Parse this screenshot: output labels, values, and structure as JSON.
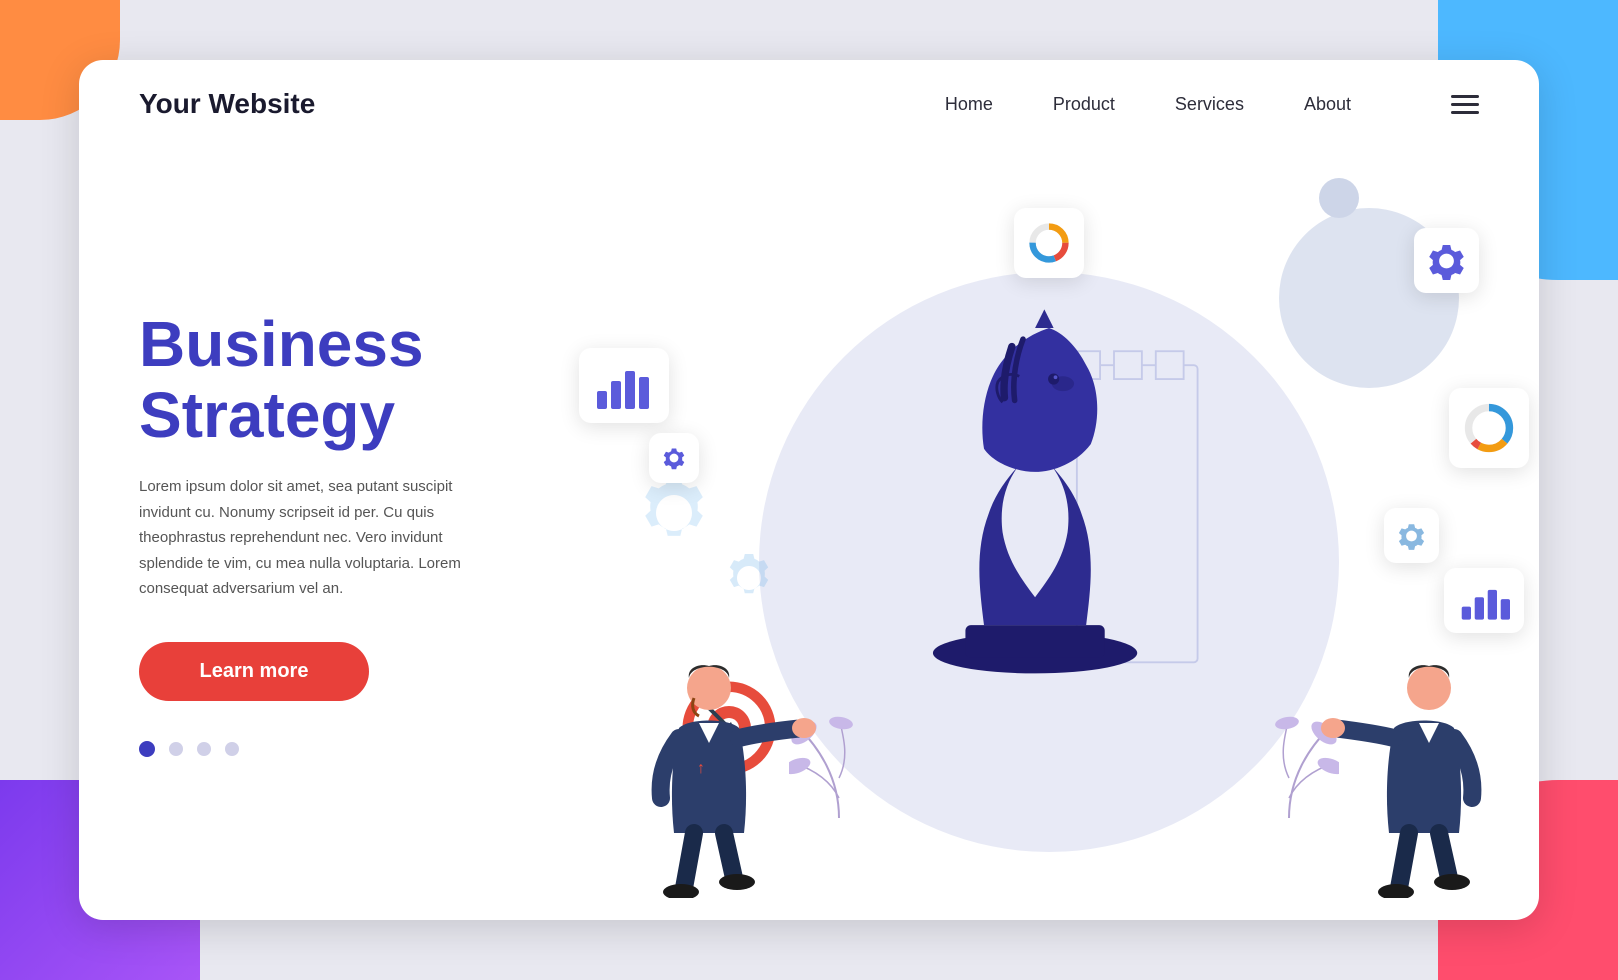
{
  "corners": {
    "tl": "orange-corner",
    "tr": "blue-corner",
    "bl": "purple-corner",
    "br": "red-corner"
  },
  "navbar": {
    "logo": "Your Website",
    "links": [
      {
        "label": "Home",
        "id": "home"
      },
      {
        "label": "Product",
        "id": "product"
      },
      {
        "label": "Services",
        "id": "services"
      },
      {
        "label": "About",
        "id": "about"
      }
    ],
    "hamburger_label": "Menu"
  },
  "hero": {
    "title_line1": "Business",
    "title_line2": "Strategy",
    "description": "Lorem ipsum dolor sit amet, sea putant suscipit invidunt cu. Nonumy scripseit id per. Cu quis theophrastus reprehendunt nec. Vero invidunt splendide te vim, cu mea nulla voluptaria. Lorem consequat adversarium vel an.",
    "cta_button": "Learn more",
    "dots": [
      {
        "active": true
      },
      {
        "active": false
      },
      {
        "active": false
      },
      {
        "active": false
      }
    ]
  },
  "colors": {
    "primary_blue": "#3d3dbf",
    "cta_red": "#e8403a",
    "accent_orange": "#ff8c42",
    "accent_blue": "#4db8ff",
    "accent_purple": "#7c3aed",
    "accent_coral": "#ff4d6d",
    "knight_color": "#2d2b8f",
    "bg_circle": "#e8eaf6"
  },
  "illustration": {
    "alt": "Business strategy illustration with chess knight and businessmen"
  }
}
